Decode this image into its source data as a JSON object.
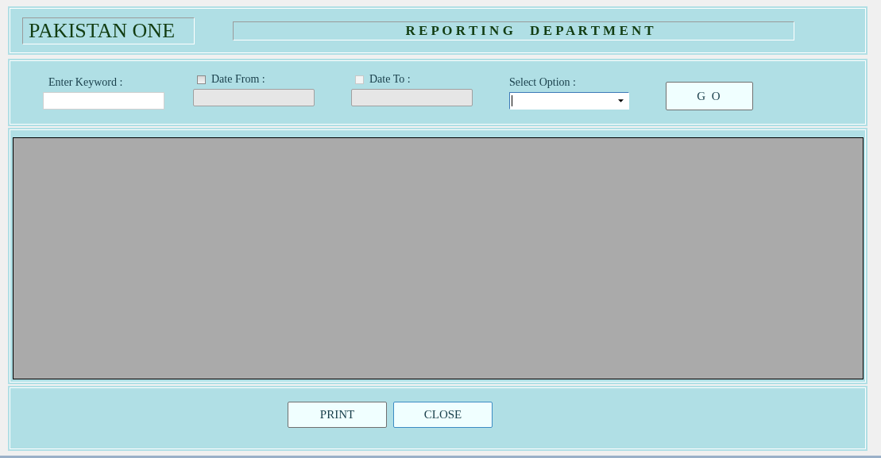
{
  "header": {
    "logo": "PAKISTAN ONE",
    "title": "R E P O R T I N G     D E P A R T M E N T"
  },
  "filters": [
    {
      "kind": "text",
      "label": "Enter Keyword :",
      "disabled": false
    },
    {
      "kind": "date",
      "label": "Date From :",
      "checked": false,
      "checkbox_disabled": false,
      "disabled": true
    },
    {
      "kind": "date",
      "label": "Date To :",
      "checked": false,
      "checkbox_disabled": true,
      "disabled": true
    },
    {
      "kind": "select",
      "label": "Select Option :",
      "disabled": false
    }
  ],
  "go_button": "G O",
  "footer_buttons": [
    "PRINT",
    "CLOSE"
  ]
}
